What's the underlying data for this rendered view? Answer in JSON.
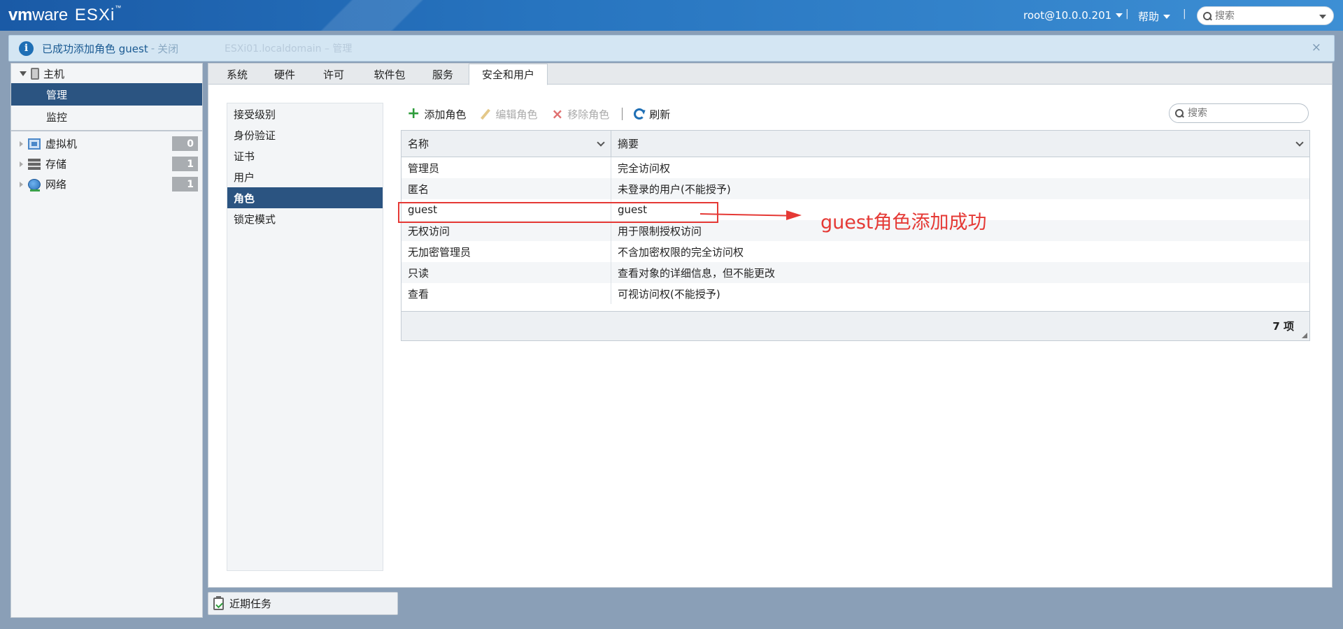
{
  "topbar": {
    "logo_vm": "vm",
    "logo_ware": "ware",
    "logo_product": "ESXi",
    "logo_tm": "™",
    "user": "root@10.0.0.201",
    "separator": "|",
    "help": "帮助",
    "search_placeholder": "搜索"
  },
  "notification": {
    "message": "已成功添加角色 guest",
    "dash": "-",
    "close_link": "关闭",
    "ghost_text": "ESXi01.localdomain – 管理",
    "close_x": "×"
  },
  "sidebar": {
    "host_label": "主机",
    "host_items": [
      {
        "label": "管理",
        "active": true
      },
      {
        "label": "监控",
        "active": false
      }
    ],
    "nav": [
      {
        "label": "虚拟机",
        "count": "0",
        "icon": "vm-icon"
      },
      {
        "label": "存储",
        "count": "1",
        "icon": "storage-icon"
      },
      {
        "label": "网络",
        "count": "1",
        "icon": "network-icon"
      }
    ]
  },
  "tabs": [
    {
      "label": "系统",
      "active": false
    },
    {
      "label": "硬件",
      "active": false
    },
    {
      "label": "许可",
      "active": false
    },
    {
      "label": "软件包",
      "active": false
    },
    {
      "label": "服务",
      "active": false
    },
    {
      "label": "安全和用户",
      "active": true
    }
  ],
  "subnav": [
    {
      "label": "接受级别",
      "active": false
    },
    {
      "label": "身份验证",
      "active": false
    },
    {
      "label": "证书",
      "active": false
    },
    {
      "label": "用户",
      "active": false
    },
    {
      "label": "角色",
      "active": true
    },
    {
      "label": "锁定模式",
      "active": false
    }
  ],
  "toolbar": {
    "add_role": "添加角色",
    "edit_role": "编辑角色",
    "remove_role": "移除角色",
    "refresh": "刷新",
    "search_placeholder": "搜索"
  },
  "grid": {
    "columns": [
      "名称",
      "摘要"
    ],
    "rows": [
      [
        "管理员",
        "完全访问权"
      ],
      [
        "匿名",
        "未登录的用户(不能授予)"
      ],
      [
        "guest",
        "guest"
      ],
      [
        "无权访问",
        "用于限制授权访问"
      ],
      [
        "无加密管理员",
        "不含加密权限的完全访问权"
      ],
      [
        "只读",
        "查看对象的详细信息，但不能更改"
      ],
      [
        "查看",
        "可视访问权(不能授予)"
      ]
    ],
    "footer_count": "7 项"
  },
  "annotation": {
    "text": "guest角色添加成功",
    "color": "#e53935"
  },
  "recent_tasks": {
    "label": "近期任务"
  },
  "colors": {
    "topbar_blue": "#2774bf",
    "selected_navy": "#2b5481",
    "notify_bg": "#d4e6f3"
  }
}
